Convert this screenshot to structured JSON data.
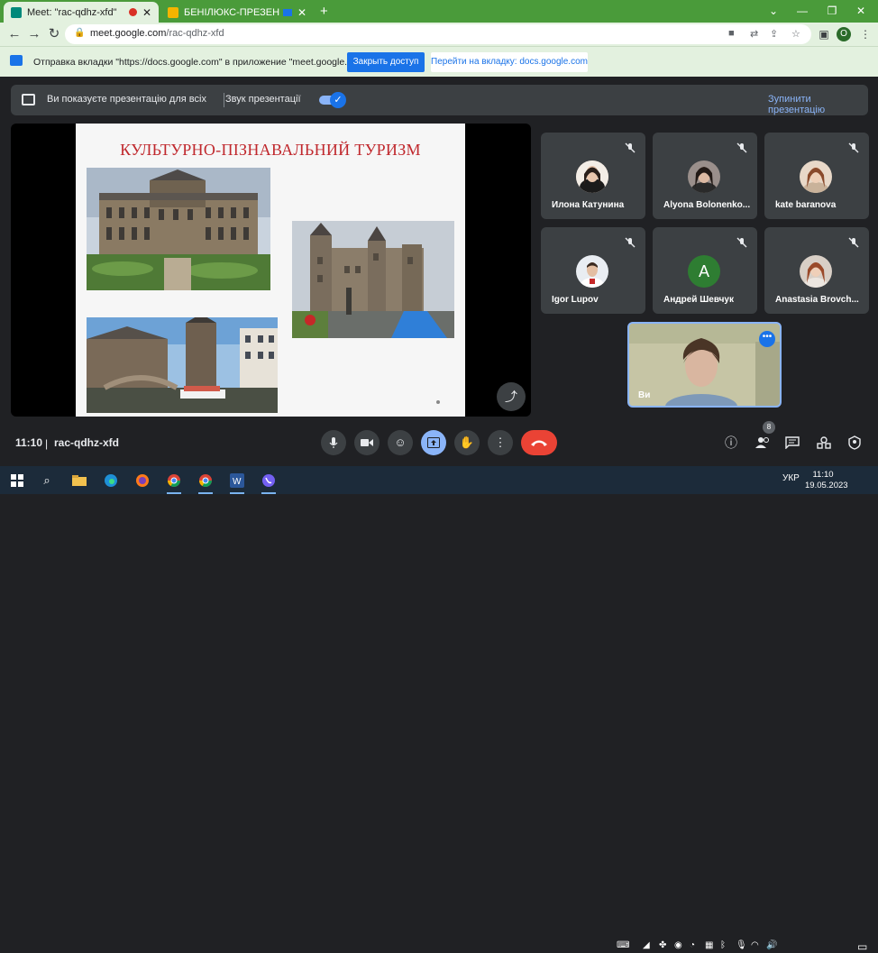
{
  "browser": {
    "tabs": [
      {
        "title": "Meet: \"rac-qdhz-xfd\"",
        "active": true,
        "favicon_color": "#00897b"
      },
      {
        "title": "БЕНІЛЮКС-ПРЕЗЕНТА.ppt",
        "active": false,
        "favicon_color": "#f4b400"
      }
    ],
    "new_tab_label": "+",
    "url_host": "meet.google.com",
    "url_path": "/rac-qdhz-xfd",
    "profile_initial": "O"
  },
  "infobar": {
    "message": "Отправка вкладки \"https://docs.google.com\" в приложение \"meet.google.com\"...",
    "primary_button": "Закрыть доступ",
    "secondary_button": "Перейти на вкладку: docs.google.com"
  },
  "presentation_bar": {
    "presenting_text": "Ви показуєте презентацію для всіх",
    "sound_label": "Звук презентації",
    "sound_on": true,
    "stop_label": "Зупинити презентацію"
  },
  "slide": {
    "title": "КУЛЬТУРНО-ПІЗНАВАЛЬНИЙ ТУРИЗМ",
    "photos": [
      "royal-palace-photo",
      "castle-photo",
      "canal-photo"
    ]
  },
  "participants": [
    {
      "name": "Илона Катунина",
      "muted": true,
      "avatar": "photo",
      "color": "#d9b9a7"
    },
    {
      "name": "Alyona Bolonenko...",
      "muted": true,
      "avatar": "photo",
      "color": "#a58f8d"
    },
    {
      "name": "kate baranova",
      "muted": true,
      "avatar": "photo",
      "color": "#c79a7e"
    },
    {
      "name": "Igor Lupov",
      "muted": true,
      "avatar": "photo",
      "color": "#dfe3ea"
    },
    {
      "name": "Андрей Шевчук",
      "muted": true,
      "avatar": "letter",
      "letter": "A",
      "color": "#2e7d32"
    },
    {
      "name": "Anastasia Brovch...",
      "muted": true,
      "avatar": "photo",
      "color": "#b46b4e"
    }
  ],
  "self_tile": {
    "name": "Ви"
  },
  "meeting": {
    "time": "11:10",
    "separator": "|",
    "code": "rac-qdhz-xfd",
    "people_count": "8"
  },
  "taskbar": {
    "language": "УКР",
    "clock_time": "11:10",
    "clock_date": "19.05.2023"
  },
  "colors": {
    "accent": "#1a73e8",
    "leave_red": "#ea4335",
    "slide_title_red": "#c0282d",
    "chrome_green": "#4a9b3a"
  }
}
